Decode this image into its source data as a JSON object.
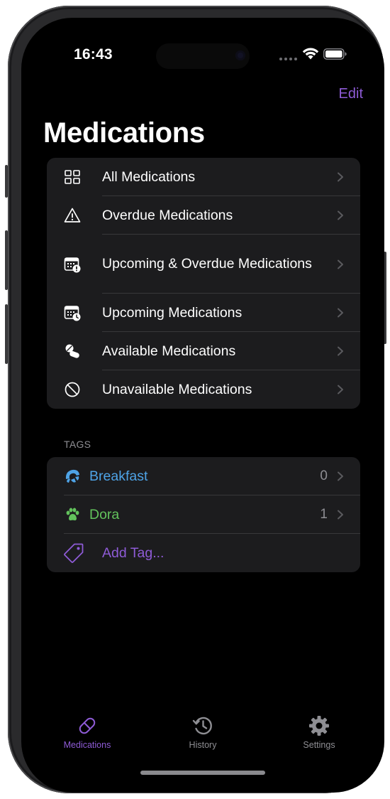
{
  "status_bar": {
    "time": "16:43"
  },
  "nav": {
    "edit_label": "Edit",
    "title": "Medications"
  },
  "menu_items": [
    {
      "label": "All Medications",
      "icon": "grid-icon"
    },
    {
      "label": "Overdue Medications",
      "icon": "warning-triangle-icon"
    },
    {
      "label": "Upcoming & Overdue Medications",
      "icon": "calendar-alert-icon"
    },
    {
      "label": "Upcoming Medications",
      "icon": "calendar-clock-icon"
    },
    {
      "label": "Available Medications",
      "icon": "pills-icon"
    },
    {
      "label": "Unavailable Medications",
      "icon": "prohibited-icon"
    }
  ],
  "tags": {
    "header": "TAGS",
    "items": [
      {
        "label": "Breakfast",
        "count": "0",
        "icon": "croissant-icon",
        "color": "#4ea3e6"
      },
      {
        "label": "Dora",
        "count": "1",
        "icon": "paw-icon",
        "color": "#62c25c"
      }
    ],
    "add_label": "Add Tag...",
    "add_icon": "tag-icon"
  },
  "tabbar": {
    "items": [
      {
        "label": "Medications",
        "icon": "pill-icon",
        "active": true
      },
      {
        "label": "History",
        "icon": "history-clock-icon",
        "active": false
      },
      {
        "label": "Settings",
        "icon": "gear-icon",
        "active": false
      }
    ]
  },
  "colors": {
    "accent": "#8e5bd6",
    "background": "#000000",
    "group_background": "#1c1c1e",
    "breakfast_tag": "#4ea3e6",
    "dora_tag": "#62c25c"
  }
}
